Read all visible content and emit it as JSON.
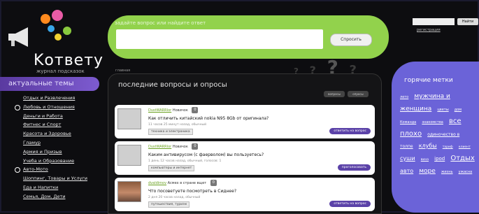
{
  "brand": {
    "name": "Kответу",
    "tagline": "журнал подсказок"
  },
  "sidebar": {
    "title": "актуальные темы",
    "items": [
      {
        "label": "Отдых и Развлечения",
        "icon": ""
      },
      {
        "label": "Любовь и Отношения",
        "icon": "circle-icon"
      },
      {
        "label": "Деньги и Работа",
        "icon": ""
      },
      {
        "label": "Фитнес и Спорт",
        "icon": ""
      },
      {
        "label": "Красота и Здоровье",
        "icon": ""
      },
      {
        "label": "Гламур",
        "icon": ""
      },
      {
        "label": "Армия и Призыв",
        "icon": ""
      },
      {
        "label": "Учеба и Образование",
        "icon": ""
      },
      {
        "label": "Авто-Мото",
        "icon": "circle-icon"
      },
      {
        "label": "Шоппинг, Товары и Услуги",
        "icon": ""
      },
      {
        "label": "Еда и Напитки",
        "icon": ""
      },
      {
        "label": "Семья, Дом, Дети",
        "icon": ""
      }
    ]
  },
  "search": {
    "hint": "задайте вопрос или найдите ответ",
    "value": "",
    "button": "Спросить"
  },
  "feed": {
    "crumb": "главная",
    "title": "последние вопросы и опросы",
    "tab_questions": "вопросы",
    "tab_polls": "опросы",
    "posts": [
      {
        "user": "DustWARRIor",
        "level": "Новичок",
        "score": "0",
        "question": "Как отличить китайский nokia N95 8Gb от оригинала?",
        "info": "11 часов 25 минут назад, обычный",
        "tags": "техника и электроника",
        "action": "ответить на вопрос"
      },
      {
        "user": "DustWARRIor",
        "level": "Новичок",
        "score": "0",
        "question": "Каким антивирусом (с фаерволом) вы пользуетесь?",
        "info": "1 день 12 часов назад, обычный, голосов: 1",
        "tags": "компьютеры и интернет",
        "action": "проголосовать"
      },
      {
        "user": "dvaldimov",
        "level": "Асмех в стране вщет",
        "score": "0",
        "question": "Что посоветуете посмотреть в Сиднее?",
        "info": "2 дня 20 часов назад, обычный",
        "tags": "путешествия, туризм",
        "action": "ответить на вопрос"
      }
    ]
  },
  "login": {
    "button": "Найти",
    "register": "регистрация"
  },
  "tagcloud": {
    "title": "горячие метки",
    "tags": [
      "лето",
      "мужчина и",
      "женщина",
      "цветы",
      "дом",
      "Команда",
      "знакомства",
      "все",
      "плохо",
      "одиночество в",
      "толпе",
      "клубы",
      "тариф",
      "клиент",
      "суши",
      "вина",
      "ipod",
      "Отдых",
      "авто",
      "море",
      "жизнь",
      "ужасна"
    ]
  },
  "colors": {
    "accent_green": "#92d24c",
    "accent_purple": "#6b63d8",
    "sidebar_purple": "#7d5bd0"
  }
}
